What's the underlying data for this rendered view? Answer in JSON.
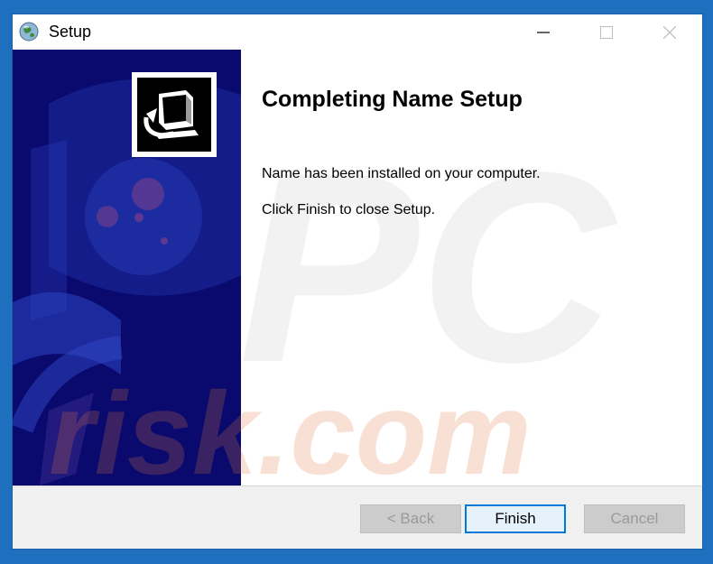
{
  "window": {
    "title": "Setup",
    "icon": "setup-globe-icon"
  },
  "titlebar_buttons": {
    "minimize": "minimize-icon",
    "maximize": "maximize-icon",
    "close": "close-icon"
  },
  "main": {
    "heading": "Completing Name Setup",
    "message1": "Name has been installed on your computer.",
    "message2": "Click Finish to close Setup."
  },
  "buttons": {
    "back": "< Back",
    "finish": "Finish",
    "cancel": "Cancel"
  },
  "watermark_text": "PC risk.com",
  "colors": {
    "side_panel": "#0a0a6e",
    "focus_border": "#0078d7",
    "desktop": "#1f6fbf"
  }
}
